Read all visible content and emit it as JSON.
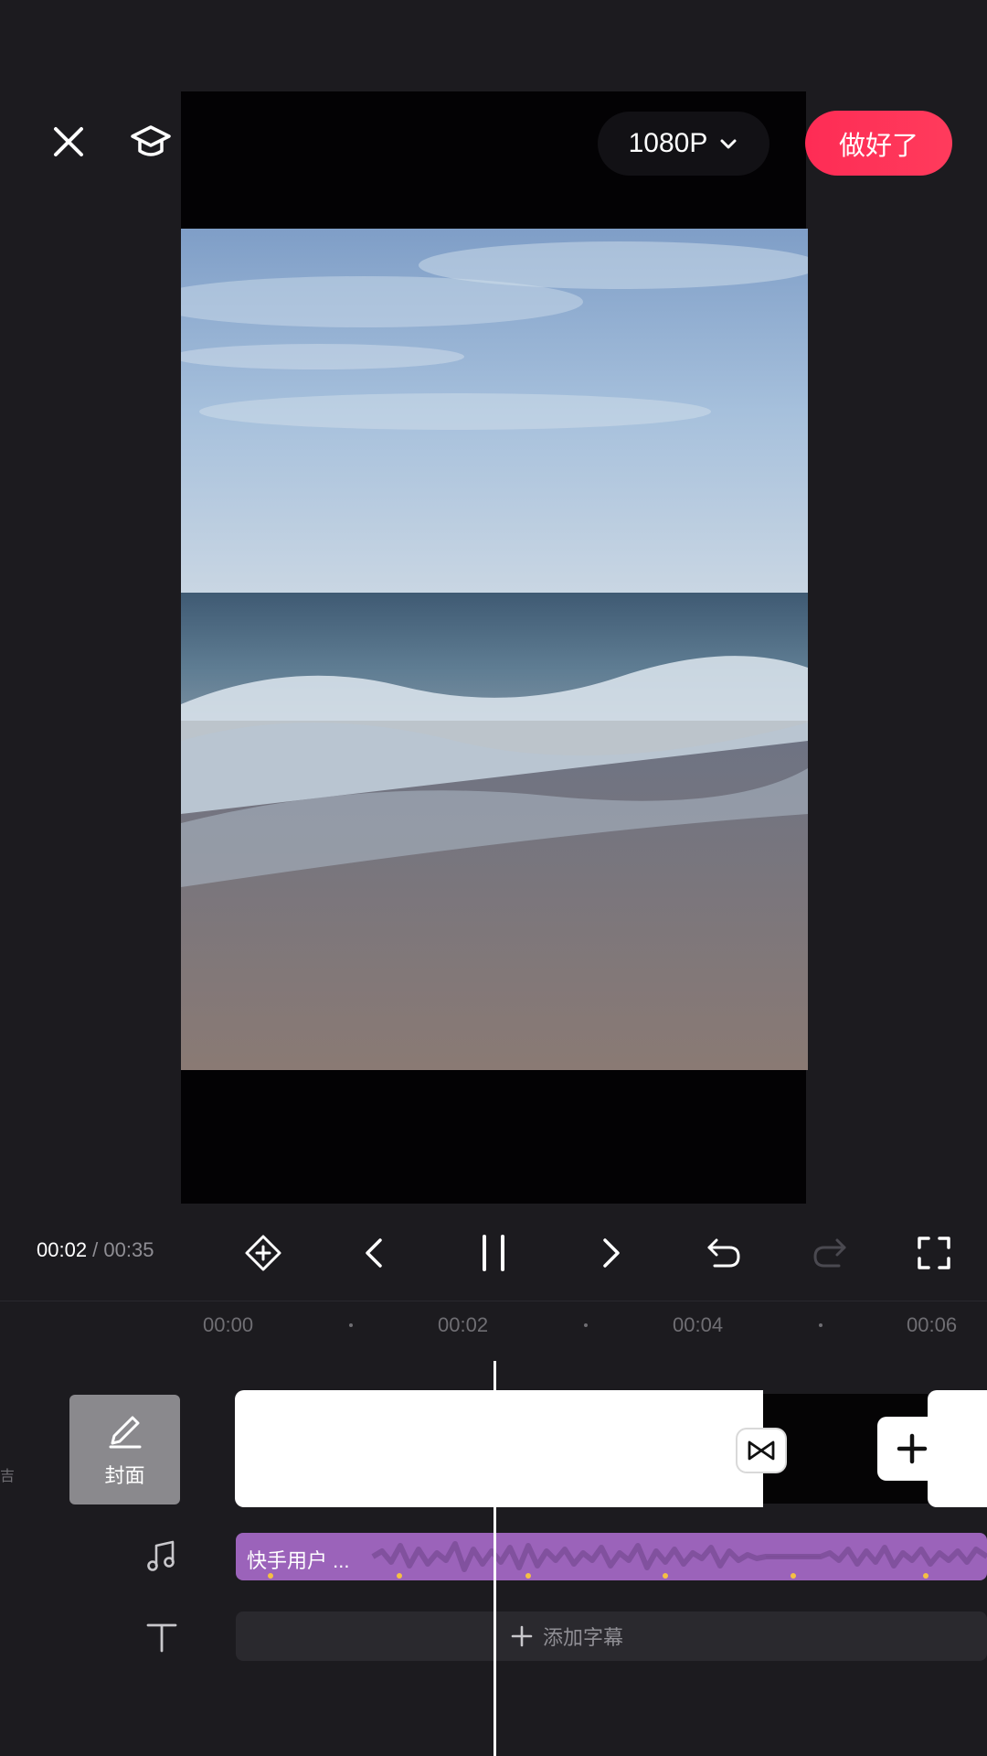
{
  "header": {
    "resolution": "1080P",
    "done_label": "做好了"
  },
  "player": {
    "current_time": "00:02",
    "separator": " / ",
    "total_time": "00:35"
  },
  "timeline": {
    "ticks": [
      "00:00",
      "00:02",
      "00:04",
      "00:06"
    ],
    "left_cut_text": "吉",
    "cover_label": "封面",
    "audio_label": "快手用户 ...",
    "subtitle_label": "添加字幕"
  },
  "colors": {
    "accent": "#fe2c55",
    "audio": "#9b63ba",
    "beat": "#f5c043"
  },
  "icons": [
    "close-icon",
    "tutorial-cap-icon",
    "chevron-down-icon",
    "keyframe-icon",
    "prev-icon",
    "pause-icon",
    "next-icon",
    "undo-icon",
    "redo-icon",
    "fullscreen-icon",
    "pencil-icon",
    "transition-icon",
    "plus-icon",
    "music-note-icon",
    "text-icon"
  ]
}
